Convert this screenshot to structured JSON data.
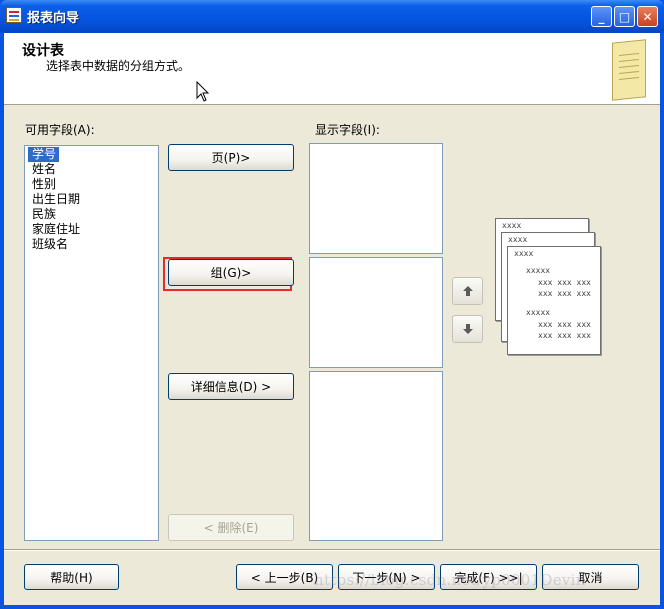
{
  "window": {
    "title": "报表向导",
    "buttons": {
      "minimize": "_",
      "maximize": "□",
      "close": "✕"
    }
  },
  "header": {
    "title": "设计表",
    "subtitle": "选择表中数据的分组方式。"
  },
  "available_fields": {
    "label": "可用字段(A):",
    "items": [
      "学号",
      "姓名",
      "性别",
      "出生日期",
      "民族",
      "家庭住址",
      "班级名"
    ],
    "selected": "学号"
  },
  "displayed_fields": {
    "label": "显示字段(I):"
  },
  "actions": {
    "page": "页(P)>",
    "group": "组(G)>",
    "details": "详细信息(D) >",
    "remove": "< 删除(E)"
  },
  "preview": {
    "header": "xxxx",
    "group": "xxxxx",
    "row": "xxx xxx xxx"
  },
  "footer": {
    "help": "帮助(H)",
    "back": "< 上一步(B)",
    "next": "下一步(N) >",
    "finish": "完成(F) >>|",
    "cancel": "取消"
  },
  "watermark": "https://blog.csdn.net/yp0001Devin"
}
